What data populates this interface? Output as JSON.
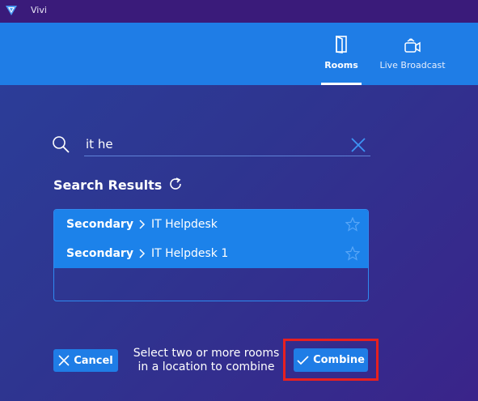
{
  "app": {
    "title": "Vivi"
  },
  "nav": {
    "tabs": [
      {
        "label": "Rooms",
        "icon": "door-icon",
        "active": true
      },
      {
        "label": "Live Broadcast",
        "icon": "video-camera-icon",
        "active": false
      }
    ]
  },
  "search": {
    "value": "it he"
  },
  "results": {
    "title": "Search Results",
    "items": [
      {
        "location": "Secondary",
        "room": "IT Helpdesk",
        "favorite": false
      },
      {
        "location": "Secondary",
        "room": "IT Helpdesk 1",
        "favorite": false
      }
    ]
  },
  "footer": {
    "cancel_label": "Cancel",
    "hint_line1": "Select two or more rooms",
    "hint_line2": "in a location to combine",
    "combine_label": "Combine"
  },
  "colors": {
    "accent": "#1f7de6",
    "titlebar": "#3a1b7a",
    "highlight": "#e8201f"
  }
}
